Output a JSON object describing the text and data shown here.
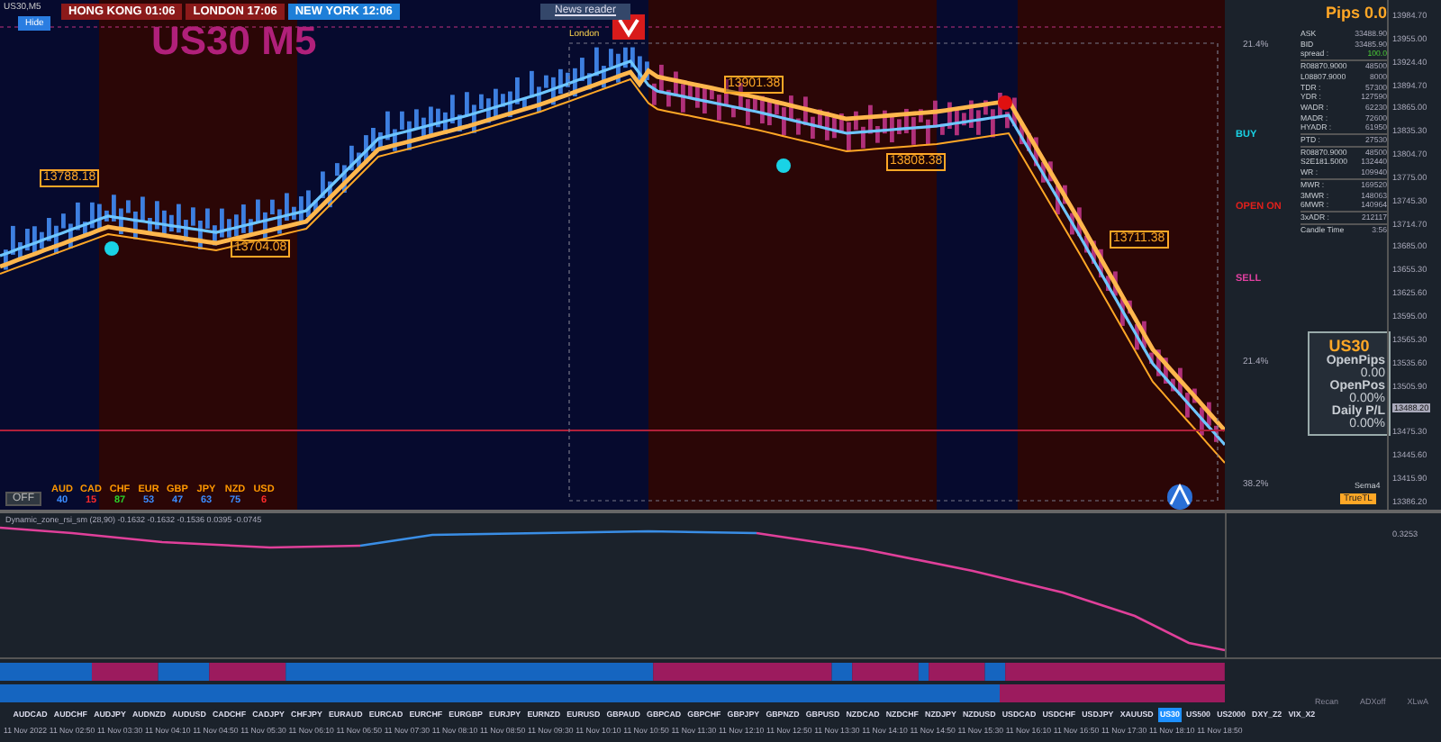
{
  "window": {
    "title": "US30,M5"
  },
  "hide_button": "Hide",
  "sessions": [
    {
      "name": "HONG KONG",
      "time": "01:06",
      "selected": false
    },
    {
      "name": "LONDON",
      "time": "17:06",
      "selected": false
    },
    {
      "name": "NEW YORK",
      "time": "12:06",
      "selected": true
    }
  ],
  "news_reader": "News reader",
  "chart": {
    "symbol_title": "US30 M5",
    "session_label": "London",
    "price_labels": [
      "13788.18",
      "13704.08",
      "13901.38",
      "13808.38",
      "13711.38"
    ],
    "signals": [
      {
        "text": "BUY",
        "color": "#19d3e6"
      },
      {
        "text": "OPEN ON",
        "color": "#e0201c"
      },
      {
        "text": "SELL",
        "color": "#e040a0"
      }
    ],
    "fib_labels": [
      "21.4%",
      "21.4%",
      "38.2%"
    ]
  },
  "info_panel": {
    "title": "Pips 0.0",
    "rows": [
      {
        "label": "ASK",
        "value": "33488.90",
        "kind": "plain"
      },
      {
        "label": "BID",
        "value": "33485.90",
        "kind": "plain"
      },
      {
        "label": "spread :",
        "value": "100.0",
        "kind": "good"
      },
      {
        "label": "R08870.9000",
        "value": "48500",
        "kind": "rule"
      },
      {
        "label": "L08807.9000",
        "value": "8000",
        "kind": "plain"
      },
      {
        "label": "TDR :",
        "value": "57300",
        "kind": "plain"
      },
      {
        "label": "YDR :",
        "value": "127590",
        "kind": "plain"
      },
      {
        "label": "WADR :",
        "value": "62230",
        "kind": "plain"
      },
      {
        "label": "MADR :",
        "value": "72600",
        "kind": "plain"
      },
      {
        "label": "HYADR :",
        "value": "61950",
        "kind": "plain"
      },
      {
        "label": "PTD :",
        "value": "27530",
        "kind": "rule"
      },
      {
        "label": "R08870.9000",
        "value": "48500",
        "kind": "rule"
      },
      {
        "label": "S2E181.5000",
        "value": "132440",
        "kind": "plain"
      },
      {
        "label": "WR :",
        "value": "109940",
        "kind": "plain"
      },
      {
        "label": "MWR :",
        "value": "169520",
        "kind": "rule"
      },
      {
        "label": "3MWR :",
        "value": "148063",
        "kind": "plain"
      },
      {
        "label": "6MWR :",
        "value": "140964",
        "kind": "plain"
      },
      {
        "label": "3xADR :",
        "value": "212117",
        "kind": "rule"
      },
      {
        "label": "Candle Time",
        "value": "3:56",
        "kind": "rule"
      }
    ]
  },
  "stats_box": {
    "symbol": "US30",
    "items": [
      {
        "label": "OpenPips",
        "value": "0.00"
      },
      {
        "label": "OpenPos",
        "value": "0.00%"
      },
      {
        "label": "Daily P/L",
        "value": "0.00%"
      }
    ]
  },
  "sema_label": "Sema4",
  "true_tl_button": "TrueTL",
  "price_axis": [
    "13984.70",
    "13955.00",
    "13924.40",
    "13894.70",
    "13865.00",
    "13835.30",
    "13804.70",
    "13775.00",
    "13745.30",
    "13714.70",
    "13685.00",
    "13655.30",
    "13625.60",
    "13595.00",
    "13565.30",
    "13535.60",
    "13505.90",
    "13475.30",
    "13445.60",
    "13415.90",
    "13386.20"
  ],
  "current_price": "13488.20",
  "currency_strength": {
    "off_button": "OFF",
    "items": [
      {
        "currency": "AUD",
        "value": "40",
        "color": "#3b8cff"
      },
      {
        "currency": "CAD",
        "value": "15",
        "color": "#ff2a2a"
      },
      {
        "currency": "CHF",
        "value": "87",
        "color": "#2ad12a"
      },
      {
        "currency": "EUR",
        "value": "53",
        "color": "#3b8cff"
      },
      {
        "currency": "GBP",
        "value": "47",
        "color": "#3b8cff"
      },
      {
        "currency": "JPY",
        "value": "63",
        "color": "#3b8cff"
      },
      {
        "currency": "NZD",
        "value": "75",
        "color": "#3b8cff"
      },
      {
        "currency": "USD",
        "value": "6",
        "color": "#ff2a2a"
      }
    ]
  },
  "indicator": {
    "label": "Dynamic_zone_rsi_sm (28,90) -0.1632 -0.1632 -0.1536 0.0395 -0.0745",
    "axis_value": "0.3253"
  },
  "bar_panel_labels": [
    "Recan",
    "ADXoff",
    "XLwA"
  ],
  "symbols": [
    {
      "name": "AUDCAD",
      "selected": false
    },
    {
      "name": "AUDCHF",
      "selected": false
    },
    {
      "name": "AUDJPY",
      "selected": false
    },
    {
      "name": "AUDNZD",
      "selected": false
    },
    {
      "name": "AUDUSD",
      "selected": false
    },
    {
      "name": "CADCHF",
      "selected": false
    },
    {
      "name": "CADJPY",
      "selected": false
    },
    {
      "name": "CHFJPY",
      "selected": false
    },
    {
      "name": "EURAUD",
      "selected": false
    },
    {
      "name": "EURCAD",
      "selected": false
    },
    {
      "name": "EURCHF",
      "selected": false
    },
    {
      "name": "EURGBP",
      "selected": false
    },
    {
      "name": "EURJPY",
      "selected": false
    },
    {
      "name": "EURNZD",
      "selected": false
    },
    {
      "name": "EURUSD",
      "selected": false
    },
    {
      "name": "GBPAUD",
      "selected": false
    },
    {
      "name": "GBPCAD",
      "selected": false
    },
    {
      "name": "GBPCHF",
      "selected": false
    },
    {
      "name": "GBPJPY",
      "selected": false
    },
    {
      "name": "GBPNZD",
      "selected": false
    },
    {
      "name": "GBPUSD",
      "selected": false
    },
    {
      "name": "NZDCAD",
      "selected": false
    },
    {
      "name": "NZDCHF",
      "selected": false
    },
    {
      "name": "NZDJPY",
      "selected": false
    },
    {
      "name": "NZDUSD",
      "selected": false
    },
    {
      "name": "USDCAD",
      "selected": false
    },
    {
      "name": "USDCHF",
      "selected": false
    },
    {
      "name": "USDJPY",
      "selected": false
    },
    {
      "name": "XAUUSD",
      "selected": false
    },
    {
      "name": "US30",
      "selected": true
    },
    {
      "name": "US500",
      "selected": false
    },
    {
      "name": "US2000",
      "selected": false
    },
    {
      "name": "DXY_Z2",
      "selected": false
    },
    {
      "name": "VIX_X2",
      "selected": false
    }
  ],
  "time_axis": [
    "11 Nov 2022",
    "11 Nov 02:50",
    "11 Nov 03:30",
    "11 Nov 04:10",
    "11 Nov 04:50",
    "11 Nov 05:30",
    "11 Nov 06:10",
    "11 Nov 06:50",
    "11 Nov 07:30",
    "11 Nov 08:10",
    "11 Nov 08:50",
    "11 Nov 09:30",
    "11 Nov 10:10",
    "11 Nov 10:50",
    "11 Nov 11:30",
    "11 Nov 12:10",
    "11 Nov 12:50",
    "11 Nov 13:30",
    "11 Nov 14:10",
    "11 Nov 14:50",
    "11 Nov 15:30",
    "11 Nov 16:10",
    "11 Nov 16:50",
    "11 Nov 17:30",
    "11 Nov 18:10",
    "11 Nov 18:50"
  ]
}
